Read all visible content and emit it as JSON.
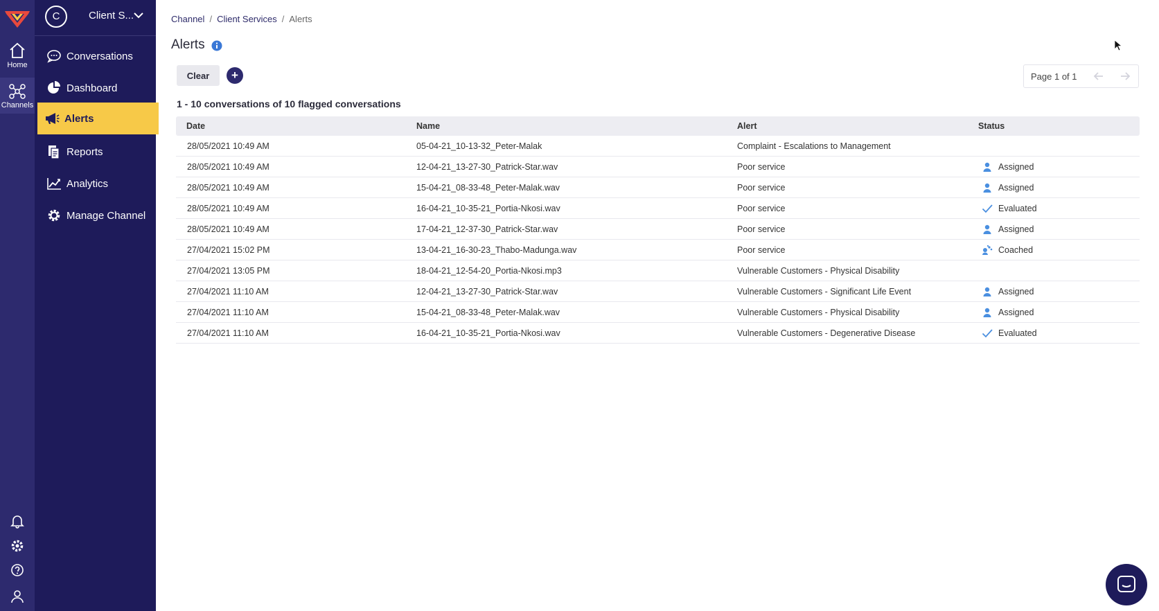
{
  "rail": {
    "home_label": "Home",
    "channels_label": "Channels"
  },
  "channel_switcher": {
    "avatar_letter": "C",
    "name": "Client S..."
  },
  "nav": {
    "items": [
      {
        "label": "Conversations",
        "icon": "chat-bubbles-icon"
      },
      {
        "label": "Dashboard",
        "icon": "pie-chart-icon"
      },
      {
        "label": "Alerts",
        "icon": "megaphone-icon",
        "active": true
      },
      {
        "label": "Reports",
        "icon": "documents-icon"
      },
      {
        "label": "Analytics",
        "icon": "line-chart-icon"
      },
      {
        "label": "Manage Channel",
        "icon": "gear-icon"
      }
    ]
  },
  "breadcrumb": {
    "items": [
      "Channel",
      "Client Services",
      "Alerts"
    ],
    "separator": "/"
  },
  "page": {
    "title": "Alerts",
    "clear_label": "Clear",
    "add_label": "+",
    "summary": "1 - 10 conversations of 10 flagged conversations"
  },
  "pager": {
    "text": "Page 1 of 1"
  },
  "table": {
    "columns": [
      "Date",
      "Name",
      "Alert",
      "Status"
    ],
    "rows": [
      {
        "date": "28/05/2021 10:49 AM",
        "name": "05-04-21_10-13-32_Peter-Malak",
        "alert": "Complaint - Escalations to Management",
        "status": "",
        "status_icon": ""
      },
      {
        "date": "28/05/2021 10:49 AM",
        "name": "12-04-21_13-27-30_Patrick-Star.wav",
        "alert": "Poor service",
        "status": "Assigned",
        "status_icon": "user-icon"
      },
      {
        "date": "28/05/2021 10:49 AM",
        "name": "15-04-21_08-33-48_Peter-Malak.wav",
        "alert": "Poor service",
        "status": "Assigned",
        "status_icon": "user-icon"
      },
      {
        "date": "28/05/2021 10:49 AM",
        "name": "16-04-21_10-35-21_Portia-Nkosi.wav",
        "alert": "Poor service",
        "status": "Evaluated",
        "status_icon": "check-icon"
      },
      {
        "date": "28/05/2021 10:49 AM",
        "name": "17-04-21_12-37-30_Patrick-Star.wav",
        "alert": "Poor service",
        "status": "Assigned",
        "status_icon": "user-icon"
      },
      {
        "date": "27/04/2021 15:02 PM",
        "name": "13-04-21_16-30-23_Thabo-Madunga.wav",
        "alert": "Poor service",
        "status": "Coached",
        "status_icon": "coach-icon"
      },
      {
        "date": "27/04/2021 13:05 PM",
        "name": "18-04-21_12-54-20_Portia-Nkosi.mp3",
        "alert": "Vulnerable Customers - Physical Disability",
        "status": "",
        "status_icon": ""
      },
      {
        "date": "27/04/2021 11:10 AM",
        "name": "12-04-21_13-27-30_Patrick-Star.wav",
        "alert": "Vulnerable Customers - Significant Life Event",
        "status": "Assigned",
        "status_icon": "user-icon"
      },
      {
        "date": "27/04/2021 11:10 AM",
        "name": "15-04-21_08-33-48_Peter-Malak.wav",
        "alert": "Vulnerable Customers - Physical Disability",
        "status": "Assigned",
        "status_icon": "user-icon"
      },
      {
        "date": "27/04/2021 11:10 AM",
        "name": "16-04-21_10-35-21_Portia-Nkosi.wav",
        "alert": "Vulnerable Customers - Degenerative Disease",
        "status": "Evaluated",
        "status_icon": "check-icon"
      }
    ]
  },
  "colors": {
    "rail": "#2d2a6e",
    "sidebar": "#1e1b5a",
    "active_nav": "#f7c948",
    "status_icon": "#4a8fe0"
  }
}
